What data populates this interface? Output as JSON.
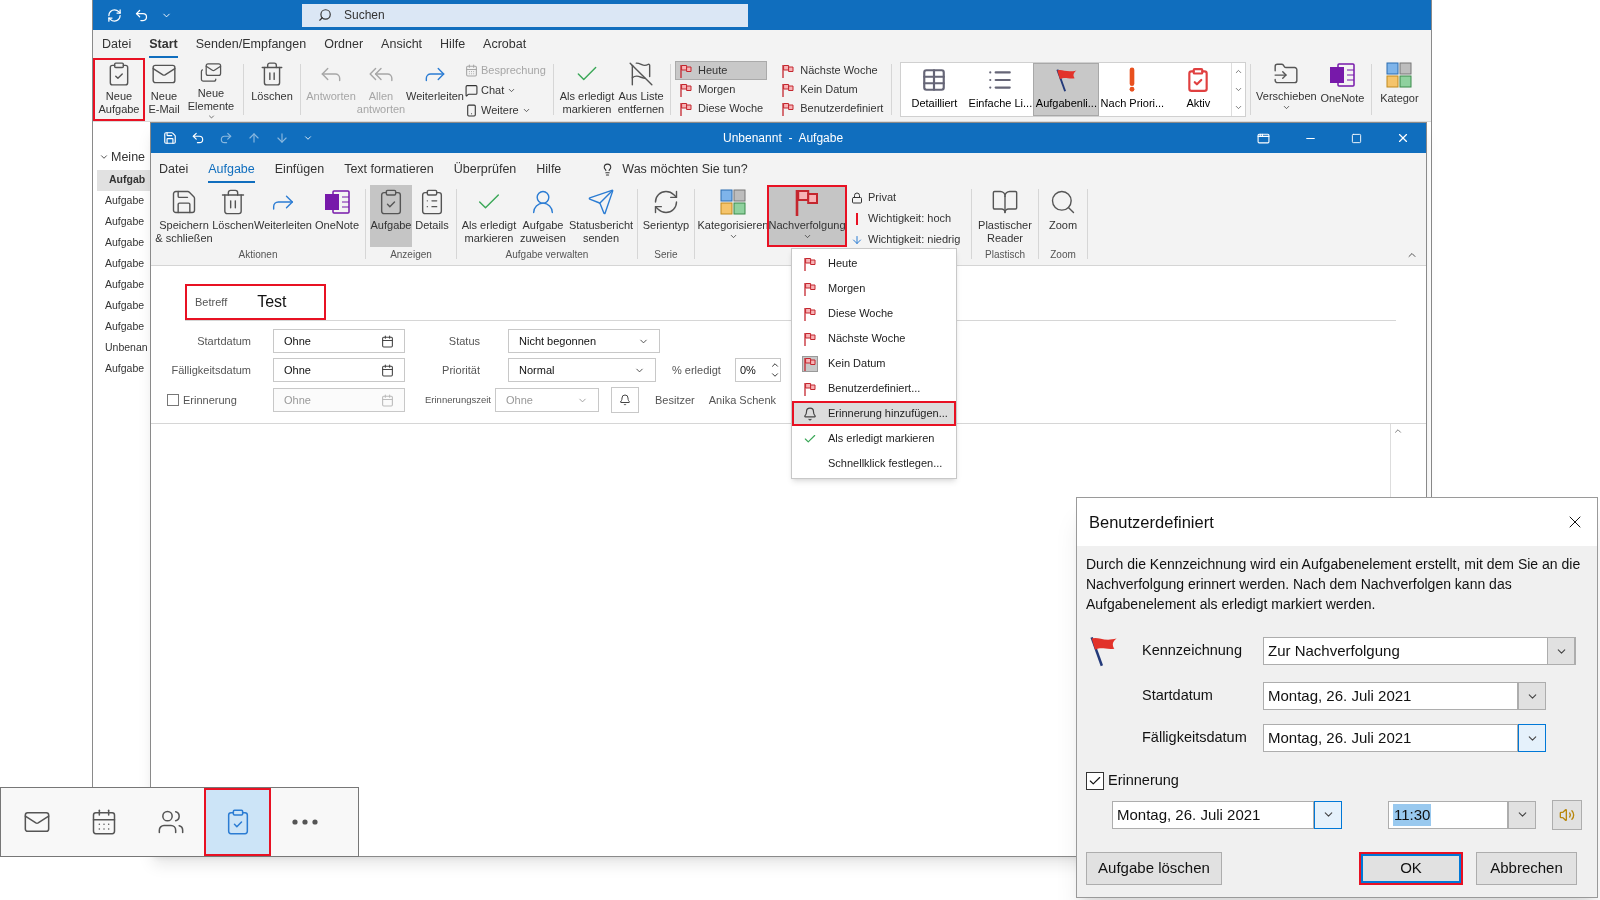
{
  "main_window": {
    "search": {
      "placeholder": "Suchen"
    },
    "menu_tabs": [
      {
        "label": "Datei",
        "selected": false
      },
      {
        "label": "Start",
        "selected": true
      },
      {
        "label": "Senden/Empfangen",
        "selected": false
      },
      {
        "label": "Ordner",
        "selected": false
      },
      {
        "label": "Ansicht",
        "selected": false
      },
      {
        "label": "Hilfe",
        "selected": false
      },
      {
        "label": "Acrobat",
        "selected": false
      }
    ],
    "ribbon": {
      "new": [
        {
          "label": "Neue Aufgabe",
          "highlighted": true,
          "menu": false
        },
        {
          "label": "Neue E-Mail",
          "highlighted": false,
          "menu": false
        },
        {
          "label": "Neue Elemente",
          "highlighted": false,
          "menu": true
        }
      ],
      "delete": {
        "label": "Löschen"
      },
      "respond": [
        {
          "label": "Antworten",
          "disabled": true
        },
        {
          "label": "Allen antworten",
          "disabled": true
        },
        {
          "label": "Weiterleiten",
          "disabled": false
        }
      ],
      "respond_more": [
        {
          "label": "Besprechung",
          "disabled": true,
          "menu": false
        },
        {
          "label": "Chat",
          "disabled": false,
          "menu": true
        },
        {
          "label": "Weitere",
          "disabled": false,
          "menu": true
        }
      ],
      "manage": [
        {
          "label": "Als erledigt markieren"
        },
        {
          "label": "Aus Liste entfernen"
        }
      ],
      "follow_up": [
        {
          "label": "Heute",
          "selected": true
        },
        {
          "label": "Morgen",
          "selected": false
        },
        {
          "label": "Diese Woche",
          "selected": false
        },
        {
          "label": "Nächste Woche",
          "selected": false
        },
        {
          "label": "Kein Datum",
          "selected": false
        },
        {
          "label": "Benutzerdefiniert",
          "selected": false
        }
      ],
      "views": [
        {
          "label": "Detailliert",
          "selected": false
        },
        {
          "label": "Einfache Li...",
          "selected": false
        },
        {
          "label": "Aufgabenli...",
          "selected": true
        },
        {
          "label": "Nach Priori...",
          "selected": false
        },
        {
          "label": "Aktiv",
          "selected": false
        }
      ],
      "actions": [
        {
          "label": "Verschieben",
          "menu": true
        },
        {
          "label": "OneNote",
          "menu": false
        }
      ],
      "column_cut": {
        "label": "Kategor"
      }
    },
    "sidebar": {
      "header": {
        "label": "Meine",
        "expanded": true
      },
      "items": [
        {
          "label": "Aufgab",
          "selected": true
        },
        {
          "label": "Aufgabe",
          "selected": false
        },
        {
          "label": "Aufgabe",
          "selected": false
        },
        {
          "label": "Aufgabe",
          "selected": false
        },
        {
          "label": "Aufgabe",
          "selected": false
        },
        {
          "label": "Aufgabe",
          "selected": false
        },
        {
          "label": "Aufgabe",
          "selected": false
        },
        {
          "label": "Aufgabe",
          "selected": false
        },
        {
          "label": "Unbenan",
          "selected": false
        },
        {
          "label": "Aufgabe",
          "selected": false
        }
      ]
    }
  },
  "task_window": {
    "title": "Unbenannt  -  Aufgabe",
    "tabs": [
      {
        "label": "Datei",
        "selected": false
      },
      {
        "label": "Aufgabe",
        "selected": true
      },
      {
        "label": "Einfügen",
        "selected": false
      },
      {
        "label": "Text formatieren",
        "selected": false
      },
      {
        "label": "Überprüfen",
        "selected": false
      },
      {
        "label": "Hilfe",
        "selected": false
      }
    ],
    "tell_me": "Was möchten Sie tun?",
    "ribbon_groups": [
      {
        "label": "Aktionen",
        "buttons": [
          {
            "label": "Speichern & schließen",
            "selected": false,
            "highlighted": false,
            "menu": false
          },
          {
            "label": "Löschen",
            "selected": false,
            "highlighted": false,
            "menu": false
          },
          {
            "label": "Weiterleiten",
            "selected": false,
            "highlighted": false,
            "menu": false
          },
          {
            "label": "OneNote",
            "selected": false,
            "highlighted": false,
            "menu": false
          }
        ]
      },
      {
        "label": "Anzeigen",
        "buttons": [
          {
            "label": "Aufgabe",
            "selected": true,
            "highlighted": false,
            "menu": false
          },
          {
            "label": "Details",
            "selected": false,
            "highlighted": false,
            "menu": false
          }
        ]
      },
      {
        "label": "Aufgabe verwalten",
        "buttons": [
          {
            "label": "Als erledigt markieren",
            "selected": false,
            "highlighted": false,
            "menu": false
          },
          {
            "label": "Aufgabe zuweisen",
            "selected": false,
            "highlighted": false,
            "menu": false
          },
          {
            "label": "Statusbericht senden",
            "selected": false,
            "highlighted": false,
            "menu": false
          }
        ]
      },
      {
        "label": "Serie",
        "buttons": [
          {
            "label": "Serientyp",
            "selected": false,
            "highlighted": false,
            "menu": false
          }
        ]
      },
      {
        "buttons": [
          {
            "label": "Kategorisieren",
            "selected": false,
            "highlighted": false,
            "menu": true
          },
          {
            "label": "Nachverfolgung",
            "selected": true,
            "highlighted": true,
            "menu": true
          }
        ],
        "small_buttons": [
          {
            "label": "Privat"
          },
          {
            "label": "Wichtigkeit: hoch"
          },
          {
            "label": "Wichtigkeit: niedrig"
          }
        ]
      },
      {
        "label": "Plastisch",
        "buttons": [
          {
            "label": "Plastischer Reader",
            "selected": false,
            "highlighted": false,
            "menu": false
          }
        ]
      },
      {
        "label": "Zoom",
        "buttons": [
          {
            "label": "Zoom",
            "selected": false,
            "highlighted": false,
            "menu": false
          }
        ]
      }
    ],
    "subject": {
      "label": "Betreff",
      "value": "Test",
      "highlighted": true
    },
    "start": {
      "label": "Startdatum",
      "value": "Ohne"
    },
    "due": {
      "label": "Fälligkeitsdatum",
      "value": "Ohne"
    },
    "reminder": {
      "label": "Erinnerung",
      "checked": false,
      "date": "Ohne",
      "time_label": "Erinnerungszeit",
      "time": "Ohne"
    },
    "status": {
      "label": "Status",
      "value": "Nicht begonnen"
    },
    "priority": {
      "label": "Priorität",
      "value": "Normal"
    },
    "percent": {
      "label": "% erledigt",
      "value": "0%"
    },
    "owner": {
      "label": "Besitzer",
      "value": "Anika Schenk"
    }
  },
  "follow_up_menu": {
    "items": [
      {
        "kind": "flag",
        "label": "Heute",
        "selected": false,
        "highlighted": false
      },
      {
        "kind": "flag",
        "label": "Morgen",
        "selected": false,
        "highlighted": false
      },
      {
        "kind": "flag",
        "label": "Diese Woche",
        "selected": false,
        "highlighted": false
      },
      {
        "kind": "flag",
        "label": "Nächste Woche",
        "selected": false,
        "highlighted": false
      },
      {
        "kind": "flag",
        "label": "Kein Datum",
        "selected": true,
        "highlighted": false
      },
      {
        "kind": "flag",
        "label": "Benutzerdefiniert...",
        "selected": false,
        "highlighted": false
      },
      {
        "kind": "bell",
        "label": "Erinnerung hinzufügen...",
        "selected": false,
        "highlighted": true
      },
      {
        "kind": "check",
        "label": "Als erledigt markieren",
        "selected": false,
        "highlighted": false
      },
      {
        "kind": "plain",
        "label": "Schnellklick festlegen...",
        "selected": false,
        "highlighted": false
      }
    ]
  },
  "dialog": {
    "title": "Benutzerdefiniert",
    "description": "Durch die Kennzeichnung wird ein Aufgabenelement erstellt, mit dem Sie an die Nachverfolgung erinnert werden. Nach dem Nachverfolgen kann das Aufgabenelement als erledigt markiert werden.",
    "flag": {
      "label": "Kennzeichnung",
      "value": "Zur Nachverfolgung"
    },
    "start": {
      "label": "Startdatum",
      "value": "Montag, 26. Juli 2021"
    },
    "due": {
      "label": "Fälligkeitsdatum",
      "value": "Montag, 26. Juli 2021"
    },
    "reminder": {
      "label": "Erinnerung",
      "checked": true,
      "date": "Montag, 26. Juli 2021",
      "time": "11:30"
    },
    "buttons": [
      {
        "label": "Aufgabe löschen",
        "highlighted": false
      },
      {
        "label": "OK",
        "highlighted": true
      },
      {
        "label": "Abbrechen",
        "highlighted": false
      }
    ]
  },
  "nav_bar": {
    "items": [
      {
        "kind": "mail",
        "selected": false,
        "highlighted": false
      },
      {
        "kind": "calendar",
        "selected": false,
        "highlighted": false
      },
      {
        "kind": "people",
        "selected": false,
        "highlighted": false
      },
      {
        "kind": "tasks",
        "selected": true,
        "highlighted": true
      },
      {
        "kind": "more",
        "selected": false,
        "highlighted": false
      }
    ]
  }
}
